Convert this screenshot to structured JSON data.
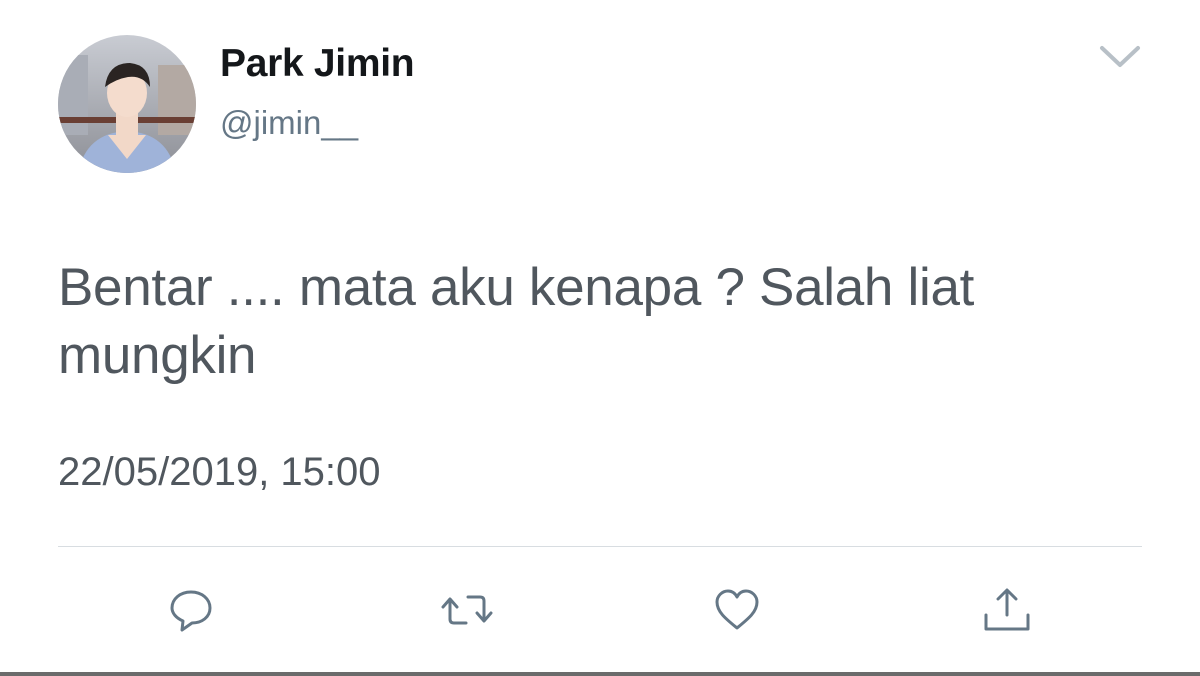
{
  "author": {
    "display_name": "Park Jimin",
    "handle": "@jimin__"
  },
  "tweet": {
    "text": "Bentar .... mata aku kenapa ? Salah liat mungkin",
    "timestamp": "22/05/2019, 15:00"
  },
  "actions": [
    "reply-icon",
    "retweet-icon",
    "like-icon",
    "share-icon"
  ],
  "colors": {
    "name": "#14171a",
    "secondary": "#657786",
    "body_text": "#50575e",
    "icon": "#657786",
    "divider": "#d8dde1"
  }
}
